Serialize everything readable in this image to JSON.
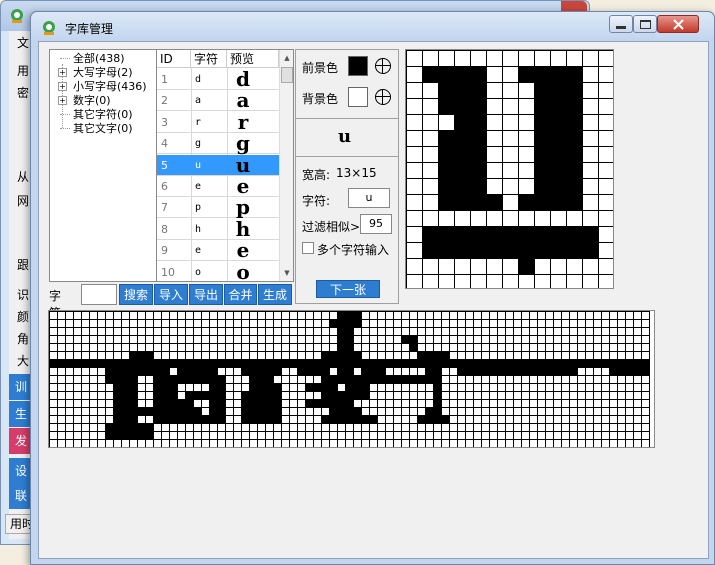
{
  "background_window": {
    "title": "...",
    "left_items": [
      "文",
      "用",
      "密",
      "从",
      "网",
      "跟",
      "识",
      "颜",
      "角",
      "大"
    ],
    "left_buttons": [
      "训",
      "生",
      "发",
      "设",
      "联"
    ],
    "status": "用时"
  },
  "window": {
    "title": "字库管理"
  },
  "tree": {
    "items": [
      {
        "label": "全部",
        "count": "(438)",
        "expandable": false
      },
      {
        "label": "大写字母",
        "count": "(2)",
        "expandable": true
      },
      {
        "label": "小写字母",
        "count": "(436)",
        "expandable": true
      },
      {
        "label": "数字",
        "count": "(0)",
        "expandable": true
      },
      {
        "label": "其它字符",
        "count": "(0)",
        "expandable": false
      },
      {
        "label": "其它文字",
        "count": "(0)",
        "expandable": false
      }
    ]
  },
  "grid": {
    "columns": [
      "ID",
      "字符",
      "预览"
    ],
    "rows": [
      {
        "id": "1",
        "char": "d",
        "preview": "d"
      },
      {
        "id": "2",
        "char": "a",
        "preview": "a"
      },
      {
        "id": "3",
        "char": "r",
        "preview": "r"
      },
      {
        "id": "4",
        "char": "g",
        "preview": "g"
      },
      {
        "id": "5",
        "char": "u",
        "preview": "u"
      },
      {
        "id": "6",
        "char": "e",
        "preview": "e"
      },
      {
        "id": "7",
        "char": "p",
        "preview": "p"
      },
      {
        "id": "8",
        "char": "h",
        "preview": "h"
      },
      {
        "id": "9",
        "char": "e",
        "preview": "e"
      },
      {
        "id": "10",
        "char": "o",
        "preview": "o"
      }
    ],
    "selected_row": 4
  },
  "search": {
    "label": "字符:",
    "value": "",
    "buttons": [
      "搜索",
      "导入",
      "导出",
      "合并",
      "生成"
    ]
  },
  "props": {
    "fg_label": "前景色",
    "bg_label": "背景色",
    "fg_color": "#000000",
    "bg_color": "#ffffff",
    "preview_char": "u",
    "size_label": "宽高:",
    "size_value": "13×15",
    "char_label": "字符:",
    "char_value": "u",
    "filter_label": "过滤相似>",
    "filter_value": "95",
    "multi_label": "多个字符输入",
    "next_button": "下一张"
  },
  "bitmap": {
    "cols": 13,
    "rows": 15,
    "pixels": [
      "0000000000000",
      "0111100111100",
      "0011100011100",
      "0011100011100",
      "0001100011100",
      "0011100011100",
      "0011100011100",
      "0011100011100",
      "0011100011100",
      "0011110111100",
      "0000000000000",
      "0111111111110",
      "0111111111110",
      "0000000100000",
      "0000000000000"
    ]
  },
  "strip": {
    "cols": 75,
    "rows": 17,
    "pixels": [
      "000000000000000000000000000000000000111000000000000000000000000000000000000",
      "000000000000000000000000000000000001111000000000000000000000000000000000000",
      "000000000000000000000000000000000000110000000000000000000000000000000000000",
      "000000000000000000000000000000000000110000001100000000000000000000000000000",
      "000000000000000000000000000000000000110000000100000000000000000000000000000",
      "000000000011100000000000000000000011111000000011110000000000000000000000000",
      "111111111111111111111111111111111111111111111111111111111111111111111111111",
      "000000011111111011111000111110011110110111000001100111111111111111000011111",
      "000000011110011111111100011100000011111111111111100000000000000000000000000",
      "000000001110011100001100011110001111011100000000100000000000000000000000000",
      "000000001110011101111100111110000011111100000000100000000000000000000000000",
      "000000001110011111001100111110001111110000000000100000000000000000000000000",
      "000000001111111111101100111110000001111000000001100000000000000000000000000",
      "000000001110011111111100111110000011111110000011110000000000000000000000000",
      "000000011111100000000000000000000000000000000000000000000000000000000000000",
      "000000011111100000000000000000000000000000000000000000000000000000000000000",
      "000000000000000000000000000000000000000000000000000000000000000000000000000"
    ]
  }
}
